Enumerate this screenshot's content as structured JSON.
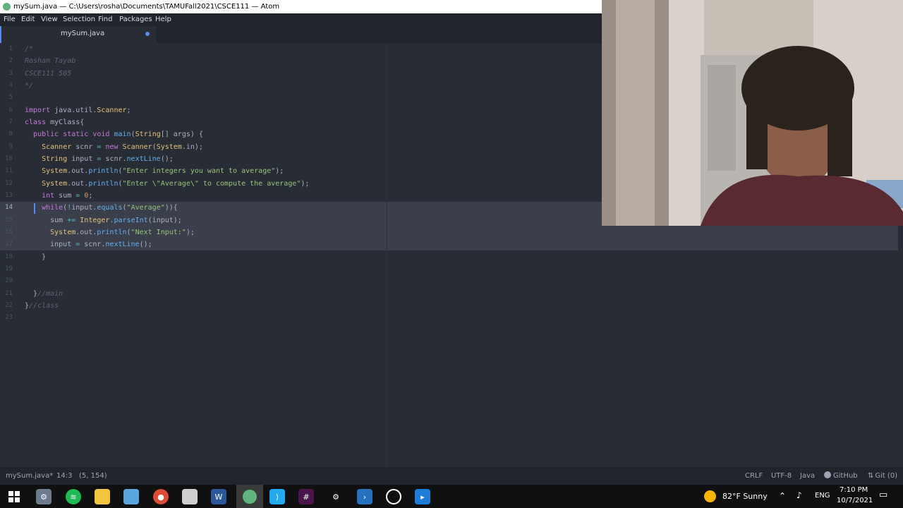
{
  "window": {
    "title": "mySum.java — C:\\Users\\rosha\\Documents\\TAMUFall2021\\CSCE111 — Atom"
  },
  "menu": [
    "File",
    "Edit",
    "View",
    "Selection",
    "Find",
    "Packages",
    "Help"
  ],
  "tab": {
    "title": "mySum.java"
  },
  "editor": {
    "line_numbers": [
      "1",
      "2",
      "3",
      "4",
      "5",
      "6",
      "7",
      "8",
      "9",
      "10",
      "11",
      "12",
      "13",
      "14",
      "15",
      "16",
      "17",
      "18",
      "19",
      "20",
      "21",
      "22",
      "23"
    ],
    "active_line": "14",
    "lines": [
      "/*",
      "Roshan Tayab",
      "CSCE111 505",
      "*/",
      "",
      "import java.util.Scanner;",
      "class myClass{",
      "  public static void main(String[] args) {",
      "    Scanner scnr = new Scanner(System.in);",
      "    String input = scnr.nextLine();",
      "    System.out.println(\"Enter integers you want to average\");",
      "    System.out.println(\"Enter \\\"Average\\\" to compute the average\");",
      "    int sum = 0;",
      "    while(!input.equals(\"Average\")){",
      "      sum += Integer.parseInt(input);",
      "      System.out.println(\"Next Input:\");",
      "      input = scnr.nextLine();",
      "    }",
      "",
      "",
      "  }//main",
      "}//class",
      ""
    ]
  },
  "status": {
    "file": "mySum.java*",
    "cursor": "14:3",
    "selection": "(5, 154)",
    "line_ending": "CRLF",
    "encoding": "UTF-8",
    "grammar": "Java",
    "github": "GitHub",
    "git": "Git (0)"
  },
  "taskbar": {
    "weather": "82°F  Sunny",
    "language": "ENG",
    "time": "7:10 PM",
    "date": "10/7/2021"
  },
  "colors": {
    "editor_bg": "#282c34",
    "chrome_bg": "#21252b",
    "accent": "#568af2",
    "keyword": "#c678dd",
    "type": "#e5c07b",
    "function": "#61afef",
    "string": "#98c379",
    "number": "#d19a66",
    "comment": "#5c6370"
  },
  "icons": [
    "windows-start-icon",
    "gear-app-icon",
    "spotify-icon",
    "file-explorer-icon",
    "notepad-icon",
    "chrome-icon",
    "folder-icon",
    "word-icon",
    "atom-icon",
    "vscode-icon",
    "slack-icon",
    "settings-icon",
    "powershell-icon",
    "github-desktop-icon",
    "terminal-icon",
    "sun-weather-icon",
    "chevron-up-icon",
    "speaker-icon",
    "notification-icon",
    "github-icon",
    "git-branch-icon"
  ]
}
